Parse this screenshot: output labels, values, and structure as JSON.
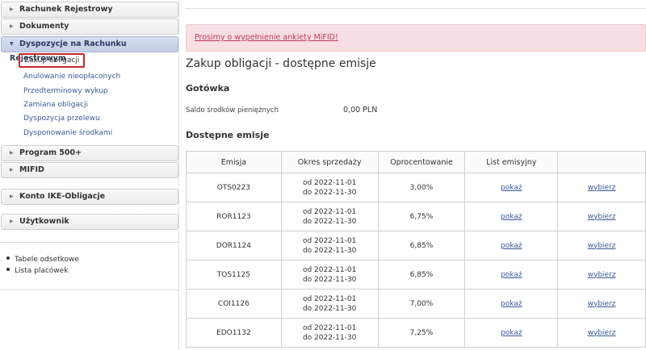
{
  "sidebar": {
    "sections": [
      {
        "label": "Rachunek Rejestrowy"
      },
      {
        "label": "Dokumenty"
      },
      {
        "label": "Dyspozycje na Rachunku Rejestrowym"
      },
      {
        "label": "Program 500+"
      },
      {
        "label": "MIFID"
      },
      {
        "label": "Konto IKE-Obligacje"
      },
      {
        "label": "Użytkownik"
      }
    ],
    "sub_items": [
      {
        "label": "Zakup obligacji"
      },
      {
        "label": "Anulowanie nieopłaconych"
      },
      {
        "label": "Przedterminowy wykup"
      },
      {
        "label": "Zamiana obligacji"
      },
      {
        "label": "Dyspozycja przelewu"
      },
      {
        "label": "Dysponowanie środkami"
      }
    ],
    "links": [
      {
        "label": "Tabele odsetkowe"
      },
      {
        "label": "Lista placówek"
      }
    ]
  },
  "alert": {
    "text": "Prosimy o wypełnienie ankiety MiFID!"
  },
  "main": {
    "title": "Zakup obligacji - dostępne emisje",
    "cash_heading": "Gotówka",
    "cash_label": "Saldo środków pieniężnych",
    "cash_value": "0,00 PLN",
    "issues_heading": "Dostępne emisje"
  },
  "table": {
    "headers": [
      "Emisja",
      "Okres sprzedaży",
      "Oprocentowanie",
      "List emisyjny",
      ""
    ],
    "action_show": "pokaż",
    "action_select": "wybierz",
    "rows": [
      {
        "emisja": "OTS0223",
        "from": "od 2022-11-01",
        "to": "do 2022-11-30",
        "rate": "3,00%"
      },
      {
        "emisja": "ROR1123",
        "from": "od 2022-11-01",
        "to": "do 2022-11-30",
        "rate": "6,75%"
      },
      {
        "emisja": "DOR1124",
        "from": "od 2022-11-01",
        "to": "do 2022-11-30",
        "rate": "6,85%"
      },
      {
        "emisja": "TOS1125",
        "from": "od 2022-11-01",
        "to": "do 2022-11-30",
        "rate": "6,85%"
      },
      {
        "emisja": "COI1126",
        "from": "od 2022-11-01",
        "to": "do 2022-11-30",
        "rate": "7,00%"
      },
      {
        "emisja": "EDO1132",
        "from": "od 2022-11-01",
        "to": "do 2022-11-30",
        "rate": "7,25%"
      }
    ]
  }
}
